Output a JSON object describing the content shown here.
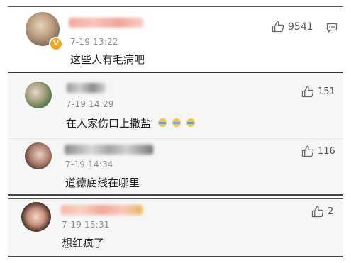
{
  "comments": [
    {
      "time": "7-19 13:22",
      "text": "这些人有毛病吧",
      "likes": "9541",
      "badge": "V"
    },
    {
      "time": "7-19 14:29",
      "text": "在人家伤口上撒盐",
      "likes": "151"
    },
    {
      "time": "7-19 14:34",
      "text": "道德底线在哪里",
      "likes": "116"
    },
    {
      "time": "7-19 15:31",
      "text": "想红疯了",
      "likes": "2"
    }
  ],
  "icons": {
    "like": "thumb-up-icon",
    "reply": "comment-icon",
    "verified": "verified-badge-icon",
    "emoji": "facepalm-emoji-icon"
  },
  "colors": {
    "badge": "#f5a623",
    "timestamp": "#8c8c8c",
    "text": "#222222"
  }
}
